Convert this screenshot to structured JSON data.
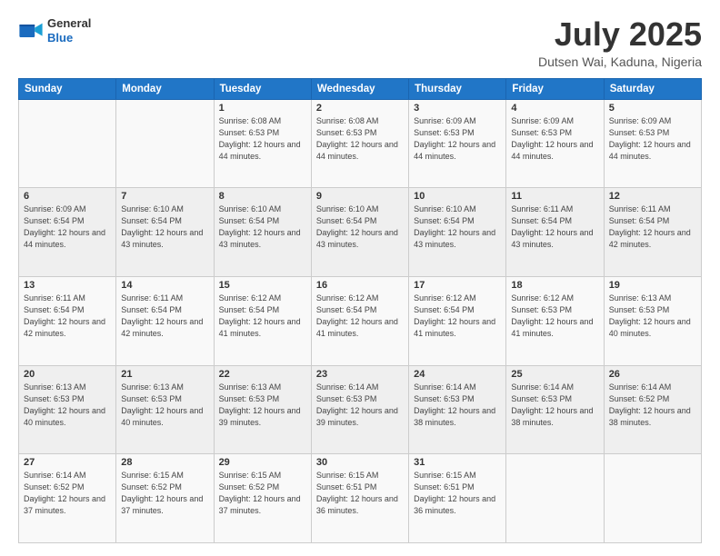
{
  "header": {
    "logo_line1": "General",
    "logo_line2": "Blue",
    "month": "July 2025",
    "location": "Dutsen Wai, Kaduna, Nigeria"
  },
  "days_of_week": [
    "Sunday",
    "Monday",
    "Tuesday",
    "Wednesday",
    "Thursday",
    "Friday",
    "Saturday"
  ],
  "weeks": [
    [
      {
        "day": "",
        "info": ""
      },
      {
        "day": "",
        "info": ""
      },
      {
        "day": "1",
        "info": "Sunrise: 6:08 AM\nSunset: 6:53 PM\nDaylight: 12 hours\nand 44 minutes."
      },
      {
        "day": "2",
        "info": "Sunrise: 6:08 AM\nSunset: 6:53 PM\nDaylight: 12 hours\nand 44 minutes."
      },
      {
        "day": "3",
        "info": "Sunrise: 6:09 AM\nSunset: 6:53 PM\nDaylight: 12 hours\nand 44 minutes."
      },
      {
        "day": "4",
        "info": "Sunrise: 6:09 AM\nSunset: 6:53 PM\nDaylight: 12 hours\nand 44 minutes."
      },
      {
        "day": "5",
        "info": "Sunrise: 6:09 AM\nSunset: 6:53 PM\nDaylight: 12 hours\nand 44 minutes."
      }
    ],
    [
      {
        "day": "6",
        "info": "Sunrise: 6:09 AM\nSunset: 6:54 PM\nDaylight: 12 hours\nand 44 minutes."
      },
      {
        "day": "7",
        "info": "Sunrise: 6:10 AM\nSunset: 6:54 PM\nDaylight: 12 hours\nand 43 minutes."
      },
      {
        "day": "8",
        "info": "Sunrise: 6:10 AM\nSunset: 6:54 PM\nDaylight: 12 hours\nand 43 minutes."
      },
      {
        "day": "9",
        "info": "Sunrise: 6:10 AM\nSunset: 6:54 PM\nDaylight: 12 hours\nand 43 minutes."
      },
      {
        "day": "10",
        "info": "Sunrise: 6:10 AM\nSunset: 6:54 PM\nDaylight: 12 hours\nand 43 minutes."
      },
      {
        "day": "11",
        "info": "Sunrise: 6:11 AM\nSunset: 6:54 PM\nDaylight: 12 hours\nand 43 minutes."
      },
      {
        "day": "12",
        "info": "Sunrise: 6:11 AM\nSunset: 6:54 PM\nDaylight: 12 hours\nand 42 minutes."
      }
    ],
    [
      {
        "day": "13",
        "info": "Sunrise: 6:11 AM\nSunset: 6:54 PM\nDaylight: 12 hours\nand 42 minutes."
      },
      {
        "day": "14",
        "info": "Sunrise: 6:11 AM\nSunset: 6:54 PM\nDaylight: 12 hours\nand 42 minutes."
      },
      {
        "day": "15",
        "info": "Sunrise: 6:12 AM\nSunset: 6:54 PM\nDaylight: 12 hours\nand 41 minutes."
      },
      {
        "day": "16",
        "info": "Sunrise: 6:12 AM\nSunset: 6:54 PM\nDaylight: 12 hours\nand 41 minutes."
      },
      {
        "day": "17",
        "info": "Sunrise: 6:12 AM\nSunset: 6:54 PM\nDaylight: 12 hours\nand 41 minutes."
      },
      {
        "day": "18",
        "info": "Sunrise: 6:12 AM\nSunset: 6:53 PM\nDaylight: 12 hours\nand 41 minutes."
      },
      {
        "day": "19",
        "info": "Sunrise: 6:13 AM\nSunset: 6:53 PM\nDaylight: 12 hours\nand 40 minutes."
      }
    ],
    [
      {
        "day": "20",
        "info": "Sunrise: 6:13 AM\nSunset: 6:53 PM\nDaylight: 12 hours\nand 40 minutes."
      },
      {
        "day": "21",
        "info": "Sunrise: 6:13 AM\nSunset: 6:53 PM\nDaylight: 12 hours\nand 40 minutes."
      },
      {
        "day": "22",
        "info": "Sunrise: 6:13 AM\nSunset: 6:53 PM\nDaylight: 12 hours\nand 39 minutes."
      },
      {
        "day": "23",
        "info": "Sunrise: 6:14 AM\nSunset: 6:53 PM\nDaylight: 12 hours\nand 39 minutes."
      },
      {
        "day": "24",
        "info": "Sunrise: 6:14 AM\nSunset: 6:53 PM\nDaylight: 12 hours\nand 38 minutes."
      },
      {
        "day": "25",
        "info": "Sunrise: 6:14 AM\nSunset: 6:53 PM\nDaylight: 12 hours\nand 38 minutes."
      },
      {
        "day": "26",
        "info": "Sunrise: 6:14 AM\nSunset: 6:52 PM\nDaylight: 12 hours\nand 38 minutes."
      }
    ],
    [
      {
        "day": "27",
        "info": "Sunrise: 6:14 AM\nSunset: 6:52 PM\nDaylight: 12 hours\nand 37 minutes."
      },
      {
        "day": "28",
        "info": "Sunrise: 6:15 AM\nSunset: 6:52 PM\nDaylight: 12 hours\nand 37 minutes."
      },
      {
        "day": "29",
        "info": "Sunrise: 6:15 AM\nSunset: 6:52 PM\nDaylight: 12 hours\nand 37 minutes."
      },
      {
        "day": "30",
        "info": "Sunrise: 6:15 AM\nSunset: 6:51 PM\nDaylight: 12 hours\nand 36 minutes."
      },
      {
        "day": "31",
        "info": "Sunrise: 6:15 AM\nSunset: 6:51 PM\nDaylight: 12 hours\nand 36 minutes."
      },
      {
        "day": "",
        "info": ""
      },
      {
        "day": "",
        "info": ""
      }
    ]
  ]
}
